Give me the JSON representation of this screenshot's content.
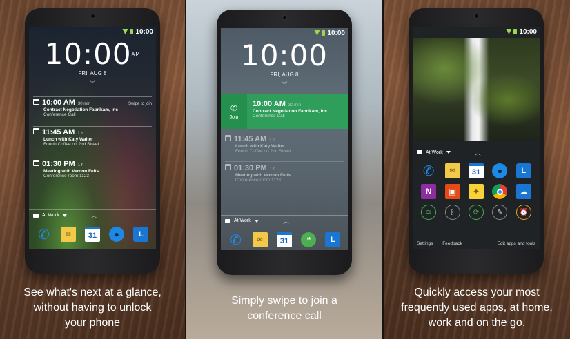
{
  "status": {
    "time": "10:00"
  },
  "panels": [
    {
      "clock": "10:00",
      "ampm": "AM",
      "date": "FRI, AUG 8",
      "events": [
        {
          "time": "10:00 AM",
          "duration": "30 min",
          "hint": "Swipe to join",
          "title": "Contract Negotiation Fabrikam, Inc",
          "location": "Conference Call"
        },
        {
          "time": "11:45 AM",
          "duration": "1 h",
          "title": "Lunch with Katy Walter",
          "location": "Fourth Coffee on 2nd Street"
        },
        {
          "time": "01:30 PM",
          "duration": "1 h",
          "title": "Meeting with Vernon Felts",
          "location": "Conference room 1123"
        }
      ],
      "context": "At Work",
      "caption": [
        "See what's next at a glance,",
        "without having to unlock",
        "your phone"
      ]
    },
    {
      "clock": "10:00",
      "date": "FRI, AUG 8",
      "join_label": "Join",
      "events": [
        {
          "time": "10:00 AM",
          "duration": "30 min",
          "title": "Contract Negotiation Fabrikam, Inc",
          "location": "Conference Call"
        },
        {
          "time": "11:45 AM",
          "duration": "1 h",
          "title": "Lunch with Katy Walter",
          "location": "Fourth Coffee on 2nd Street"
        },
        {
          "time": "01:30 PM",
          "duration": "1 h",
          "title": "Meeting with Vernon Felts",
          "location": "Conference room 1123"
        }
      ],
      "context": "At Work",
      "caption": [
        "Simply swipe to join a",
        "conference call"
      ]
    },
    {
      "context": "At Work",
      "footer": {
        "settings": "Settings",
        "divider": "|",
        "feedback": "Feedback",
        "edit": "Edit apps and tools"
      },
      "caption": [
        "Quickly access your most",
        "frequently used apps, at home,",
        "work and on the go."
      ]
    }
  ],
  "icons": {
    "phone": "phone-icon",
    "mail": "mail-icon",
    "calendar": "calendar-icon",
    "calendar_day": "31",
    "people": "people-icon",
    "lync": "lync-icon",
    "hangouts": "hangouts-icon",
    "onenote": "onenote-icon",
    "office": "office-icon",
    "keep": "keep-icon",
    "chrome": "chrome-icon",
    "onedrive": "onedrive-icon"
  },
  "colors": {
    "join_green": "#2e9e5a",
    "accent_blue": "#1976d2",
    "toggle_on": "#4caf50",
    "toggle_warn": "#f0a020"
  }
}
